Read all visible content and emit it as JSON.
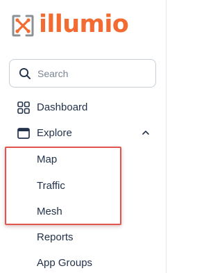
{
  "brand": {
    "name": "illumio",
    "color": "#f26b32"
  },
  "search": {
    "placeholder": "Search",
    "icon": "search-icon"
  },
  "sidebar": {
    "items": [
      {
        "label": "Dashboard",
        "icon": "dashboard-grid-icon"
      },
      {
        "label": "Explore",
        "icon": "explore-window-icon",
        "expanded": true
      }
    ],
    "explore_subitems": [
      {
        "label": "Map"
      },
      {
        "label": "Traffic"
      },
      {
        "label": "Mesh"
      },
      {
        "label": "Reports"
      },
      {
        "label": "App Groups"
      }
    ]
  },
  "annotation": {
    "highlight_color": "#e2554f"
  }
}
